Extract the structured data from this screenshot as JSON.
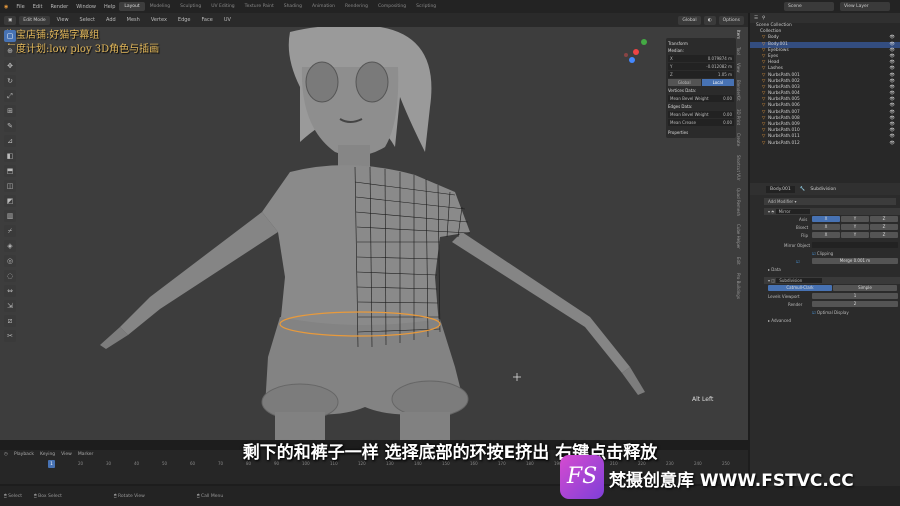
{
  "topbar": {
    "menus": [
      "File",
      "Edit",
      "Render",
      "Window",
      "Help"
    ],
    "workspaces": [
      "Layout",
      "Modeling",
      "Sculpting",
      "UV Editing",
      "Texture Paint",
      "Shading",
      "Animation",
      "Rendering",
      "Compositing",
      "Scripting"
    ],
    "active_workspace": "Layout",
    "scene": "Scene",
    "view_layer": "View Layer"
  },
  "viewport_header": {
    "mode": "Edit Mode",
    "menus": [
      "View",
      "Select",
      "Add",
      "Mesh",
      "Vertex",
      "Edge",
      "Face",
      "UV"
    ],
    "orientation": "Global",
    "options": "Options"
  },
  "overlay_text": {
    "line1": "淘宝店铺:好猫字幕组",
    "line2": "年度计划:low ploy 3D角色与插画"
  },
  "npanel": {
    "header": "Transform",
    "median_label": "Median:",
    "x": "0.079874 m",
    "y": "-0.012082 m",
    "z": "1.05 m",
    "global": "Global",
    "local": "Local",
    "vertices_data": "Vertices Data:",
    "mean_bevel_weight": "Mean Bevel Weight",
    "mbw_value": "0.00",
    "edges_data": "Edges Data:",
    "mean_bevel_weight2": "Mean Bevel Weight",
    "mbw2_value": "0.00",
    "mean_crease": "Mean Crease",
    "mc_value": "0.00",
    "properties": "Properties"
  },
  "sidetabs": [
    "Item",
    "Tool",
    "View",
    "BlenderKit",
    "3D Print",
    "Create",
    "Shortcut VUr",
    "Quad Remesh",
    "Cube Helper",
    "Edit",
    "Pro Buildings"
  ],
  "alt_left": "Alt Left",
  "subtitle": "剩下的和裤子一样 选择底部的环按E挤出 右键点击释放",
  "timeline": {
    "menus": [
      "Playback",
      "Keying",
      "View",
      "Marker"
    ],
    "current_frame": "1",
    "ticks": [
      "10",
      "20",
      "30",
      "40",
      "50",
      "60",
      "70",
      "80",
      "90",
      "100",
      "110",
      "120",
      "130",
      "140",
      "150",
      "160",
      "170",
      "180",
      "190",
      "200",
      "210",
      "220",
      "230",
      "240",
      "250"
    ]
  },
  "statusbar": {
    "items": [
      "Select",
      "Box Select",
      "Rotate View",
      "Call Menu"
    ]
  },
  "outliner": {
    "title": "Scene Collection",
    "collection": "Collection",
    "items": [
      {
        "name": "Body",
        "selected": false
      },
      {
        "name": "Body.001",
        "selected": true
      },
      {
        "name": "Eyebrows",
        "selected": false
      },
      {
        "name": "Eyes",
        "selected": false
      },
      {
        "name": "Head",
        "selected": false
      },
      {
        "name": "Lashes",
        "selected": false
      },
      {
        "name": "NurbsPath.001",
        "selected": false
      },
      {
        "name": "NurbsPath.002",
        "selected": false
      },
      {
        "name": "NurbsPath.003",
        "selected": false
      },
      {
        "name": "NurbsPath.004",
        "selected": false
      },
      {
        "name": "NurbsPath.005",
        "selected": false
      },
      {
        "name": "NurbsPath.006",
        "selected": false
      },
      {
        "name": "NurbsPath.007",
        "selected": false
      },
      {
        "name": "NurbsPath.008",
        "selected": false
      },
      {
        "name": "NurbsPath.009",
        "selected": false
      },
      {
        "name": "NurbsPath.010",
        "selected": false
      },
      {
        "name": "NurbsPath.011",
        "selected": false
      },
      {
        "name": "NurbsPath.012",
        "selected": false
      }
    ]
  },
  "properties": {
    "object": "Body.001",
    "modifier_tab": "Subdivision",
    "add_modifier": "Add Modifier",
    "mirror": {
      "name": "Mirror",
      "axis_label": "Axis",
      "bisect_label": "Bisect",
      "flip_label": "Flip",
      "x": "X",
      "y": "Y",
      "z": "Z",
      "mirror_object": "Mirror Object",
      "clipping": "Clipping",
      "merge_label": "Merge",
      "merge_value": "0.001 m",
      "data": "Data"
    },
    "subsurf": {
      "name": "Subdivision",
      "catmull": "Catmull-Clark",
      "simple": "Simple",
      "levels_viewport": "Levels Viewport",
      "levels_value": "1",
      "render": "Render",
      "render_value": "2",
      "optimal_display": "Optimal Display",
      "advanced": "Advanced"
    }
  },
  "watermark": {
    "mark": "FS",
    "text": "梵摄创意库 WWW.FSTVC.CC"
  }
}
